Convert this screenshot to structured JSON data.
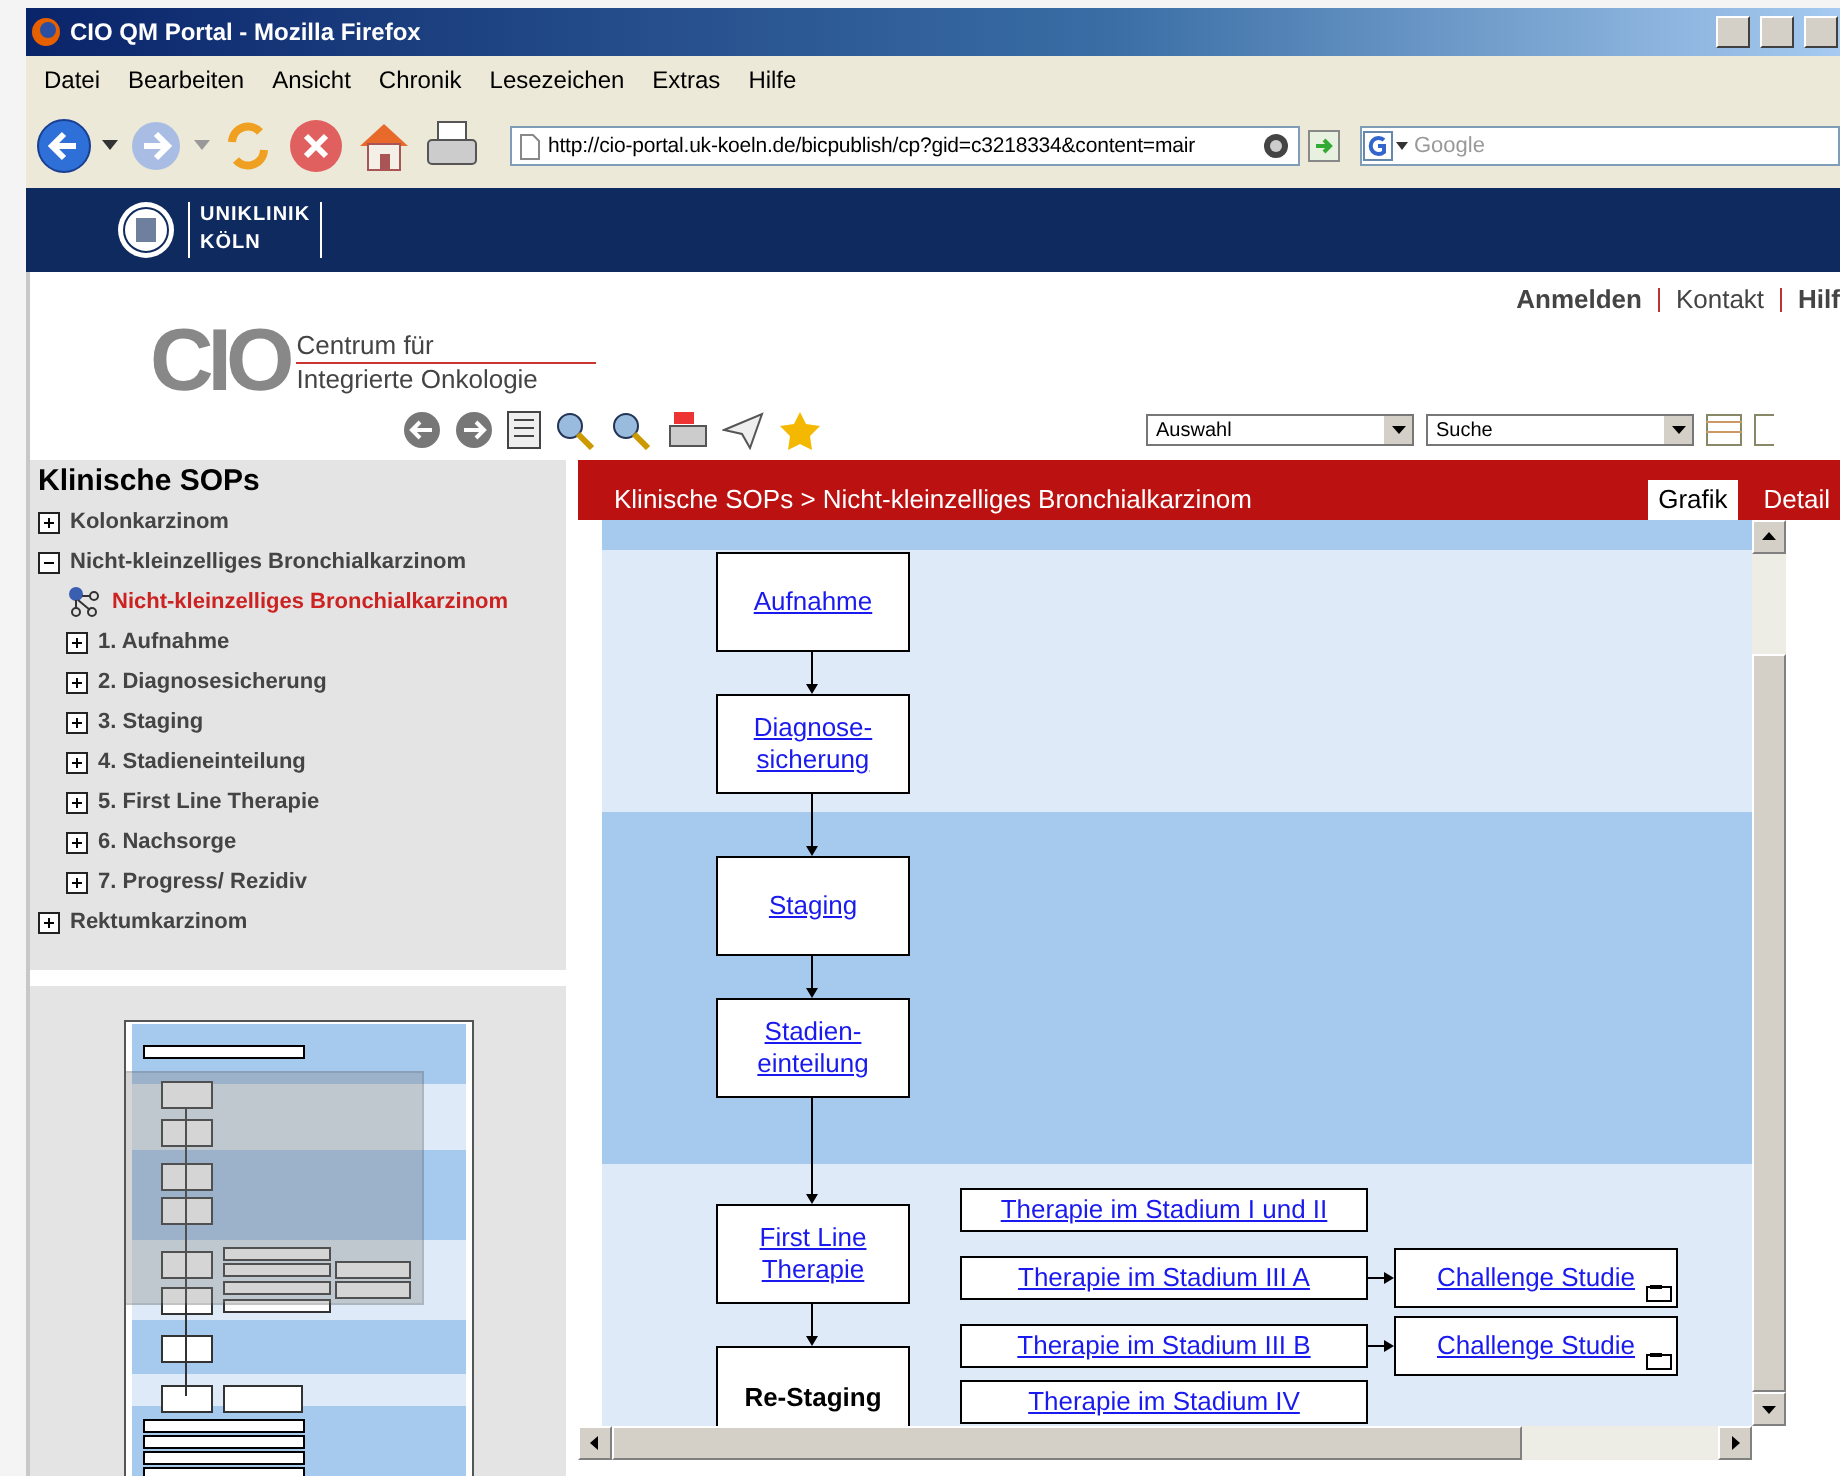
{
  "window": {
    "title": "CIO QM Portal - Mozilla Firefox"
  },
  "menu": [
    "Datei",
    "Bearbeiten",
    "Ansicht",
    "Chronik",
    "Lesezeichen",
    "Extras",
    "Hilfe"
  ],
  "address_bar": {
    "url": "http://cio-portal.uk-koeln.de/bicpublish/cp?gid=c3218334&content=mair"
  },
  "search_field": {
    "placeholder": "Google"
  },
  "banner": {
    "logo_lines": [
      "UNIKLINIK",
      "KÖLN"
    ]
  },
  "top_links": [
    {
      "label": "Anmelden",
      "bold": true
    },
    {
      "label": "Kontakt",
      "bold": false
    },
    {
      "label": "Hilf",
      "bold": true
    }
  ],
  "logo": {
    "mark": "CIO",
    "line_1": "Centrum für",
    "line_2": "Integrierte Onkologie"
  },
  "dropdowns": [
    "Auswahl",
    "Suche"
  ],
  "sidebar": {
    "title": "Klinische SOPs",
    "tree": [
      {
        "label": "Kolonkarzinom",
        "kind": "folder",
        "expanded": false,
        "selected": false
      },
      {
        "label": "Nicht-kleinzelliges Bronchialkarzinom",
        "kind": "folder",
        "expanded": true,
        "selected": false,
        "children": [
          {
            "label": "Nicht-kleinzelliges Bronchialkarzinom",
            "kind": "sop",
            "selected": true
          },
          {
            "label": "1. Aufnahme",
            "kind": "folder",
            "expanded": false,
            "selected": false
          },
          {
            "label": "2. Diagnosesicherung",
            "kind": "folder",
            "expanded": false,
            "selected": false
          },
          {
            "label": "3. Staging",
            "kind": "folder",
            "expanded": false,
            "selected": false
          },
          {
            "label": "4. Stadieneinteilung",
            "kind": "folder",
            "expanded": false,
            "selected": false
          },
          {
            "label": "5. First Line Therapie",
            "kind": "folder",
            "expanded": false,
            "selected": false
          },
          {
            "label": "6. Nachsorge",
            "kind": "folder",
            "expanded": false,
            "selected": false
          },
          {
            "label": "7. Progress/ Rezidiv",
            "kind": "folder",
            "expanded": false,
            "selected": false
          }
        ]
      },
      {
        "label": "Rektumkarzinom",
        "kind": "folder",
        "expanded": false,
        "selected": false
      }
    ]
  },
  "breadcrumb": "Klinische SOPs > Nicht-kleinzelliges Bronchialkarzinom",
  "view_tabs": [
    {
      "label": "Grafik",
      "selected": true
    },
    {
      "label": "Detail",
      "selected": false
    }
  ],
  "flowchart": {
    "chain": [
      {
        "label": "Aufnahme",
        "kind": "link"
      },
      {
        "label": "Diagnose-\nsicherung",
        "kind": "link"
      },
      {
        "label": "Staging",
        "kind": "link"
      },
      {
        "label": "Stadien-\neinteilung",
        "kind": "link"
      },
      {
        "label": "First Line\nTherapie",
        "kind": "link"
      },
      {
        "label": "Re-Staging",
        "kind": "plain"
      }
    ],
    "therapies": [
      {
        "label": "Therapie im Stadium I und II"
      },
      {
        "label": "Therapie im Stadium III A",
        "study": {
          "label": "Challenge Studie",
          "document": true
        }
      },
      {
        "label": "Therapie im Stadium III B",
        "study": {
          "label": "Challenge Studie",
          "document": true
        }
      },
      {
        "label": "Therapie im Stadium IV"
      }
    ]
  }
}
